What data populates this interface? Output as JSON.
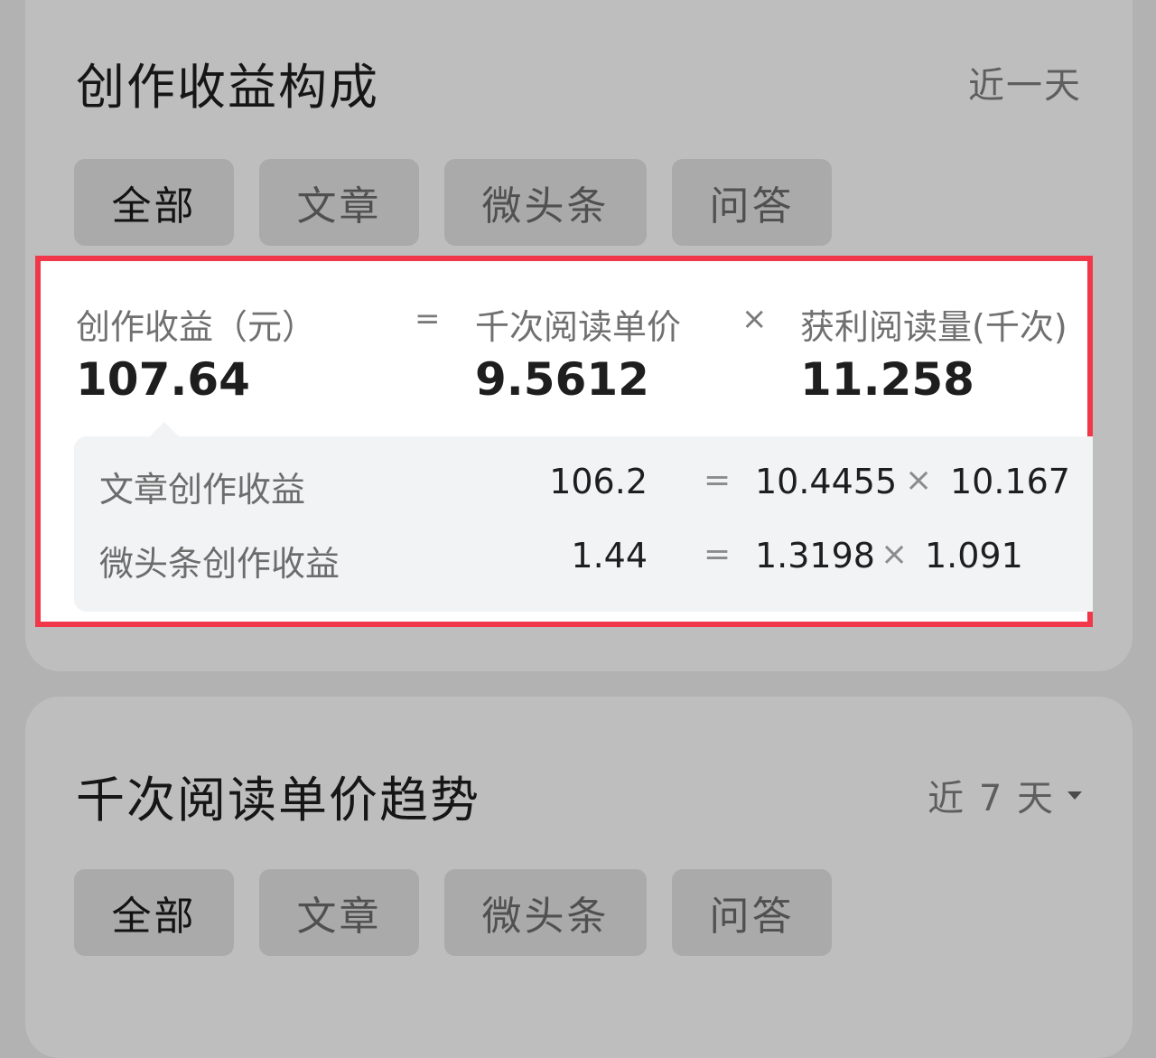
{
  "composition": {
    "title": "创作收益构成",
    "range": "近一天",
    "tabs": [
      "全部",
      "文章",
      "微头条",
      "问答"
    ],
    "formula": {
      "total_label": "创作收益（元）",
      "total_value": "107.64",
      "equals": "=",
      "unit_price_label": "千次阅读单价",
      "unit_price_value": "9.5612",
      "times": "×",
      "reads_label": "获利阅读量(千次)",
      "reads_value": "11.258"
    },
    "breakdown": [
      {
        "label": "文章创作收益",
        "income": "106.2",
        "unit_price": "10.4455",
        "reads": "10.167"
      },
      {
        "label": "微头条创作收益",
        "income": "1.44",
        "unit_price": "1.3198",
        "reads": "1.091"
      }
    ]
  },
  "trend": {
    "title": "千次阅读单价趋势",
    "range": "近 7 天",
    "tabs": [
      "全部",
      "文章",
      "微头条",
      "问答"
    ]
  },
  "colors": {
    "highlight_border": "#f0384a",
    "overlay": "#b2b2b2"
  },
  "icons": {
    "range_dropdown": "caret-down-icon"
  }
}
